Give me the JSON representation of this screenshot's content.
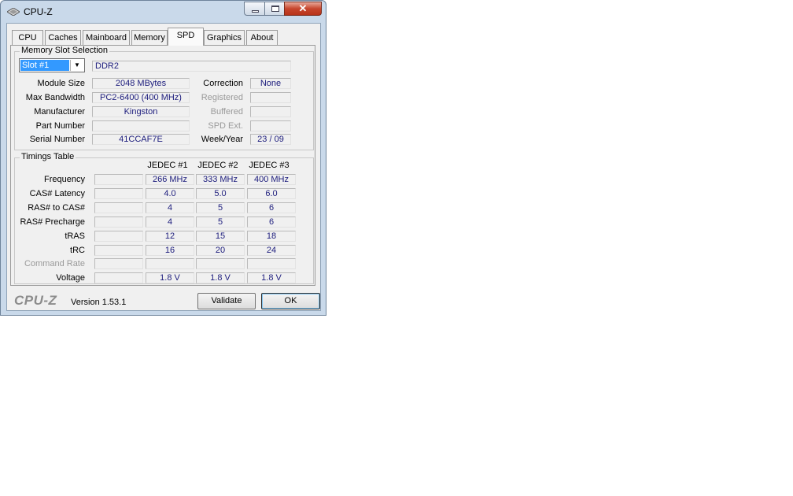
{
  "window": {
    "title": "CPU-Z"
  },
  "tabs": [
    "CPU",
    "Caches",
    "Mainboard",
    "Memory",
    "SPD",
    "Graphics",
    "About"
  ],
  "active_tab": "SPD",
  "slot_section": {
    "title": "Memory Slot Selection",
    "slot_selected": "Slot #1",
    "memory_type": "DDR2",
    "labels": {
      "module_size": "Module Size",
      "max_bandwidth": "Max Bandwidth",
      "manufacturer": "Manufacturer",
      "part_number": "Part Number",
      "serial_number": "Serial Number",
      "correction": "Correction",
      "registered": "Registered",
      "buffered": "Buffered",
      "spd_ext": "SPD Ext.",
      "week_year": "Week/Year"
    },
    "values": {
      "module_size": "2048 MBytes",
      "max_bandwidth": "PC2-6400 (400 MHz)",
      "manufacturer": "Kingston",
      "part_number": "",
      "serial_number": "41CCAF7E",
      "correction": "None",
      "registered": "",
      "buffered": "",
      "spd_ext": "",
      "week_year": "23 / 09"
    }
  },
  "timings": {
    "title": "Timings Table",
    "columns": [
      "JEDEC #1",
      "JEDEC #2",
      "JEDEC #3"
    ],
    "rows": [
      {
        "label": "Frequency",
        "values": [
          "266 MHz",
          "333 MHz",
          "400 MHz"
        ]
      },
      {
        "label": "CAS# Latency",
        "values": [
          "4.0",
          "5.0",
          "6.0"
        ]
      },
      {
        "label": "RAS# to CAS#",
        "values": [
          "4",
          "5",
          "6"
        ]
      },
      {
        "label": "RAS# Precharge",
        "values": [
          "4",
          "5",
          "6"
        ]
      },
      {
        "label": "tRAS",
        "values": [
          "12",
          "15",
          "18"
        ]
      },
      {
        "label": "tRC",
        "values": [
          "16",
          "20",
          "24"
        ]
      },
      {
        "label": "Command Rate",
        "values": [
          "",
          "",
          ""
        ]
      },
      {
        "label": "Voltage",
        "values": [
          "1.8 V",
          "1.8 V",
          "1.8 V"
        ]
      }
    ]
  },
  "footer": {
    "logo": "CPU-Z",
    "version": "Version 1.53.1",
    "validate_label": "Validate",
    "ok_label": "OK"
  }
}
